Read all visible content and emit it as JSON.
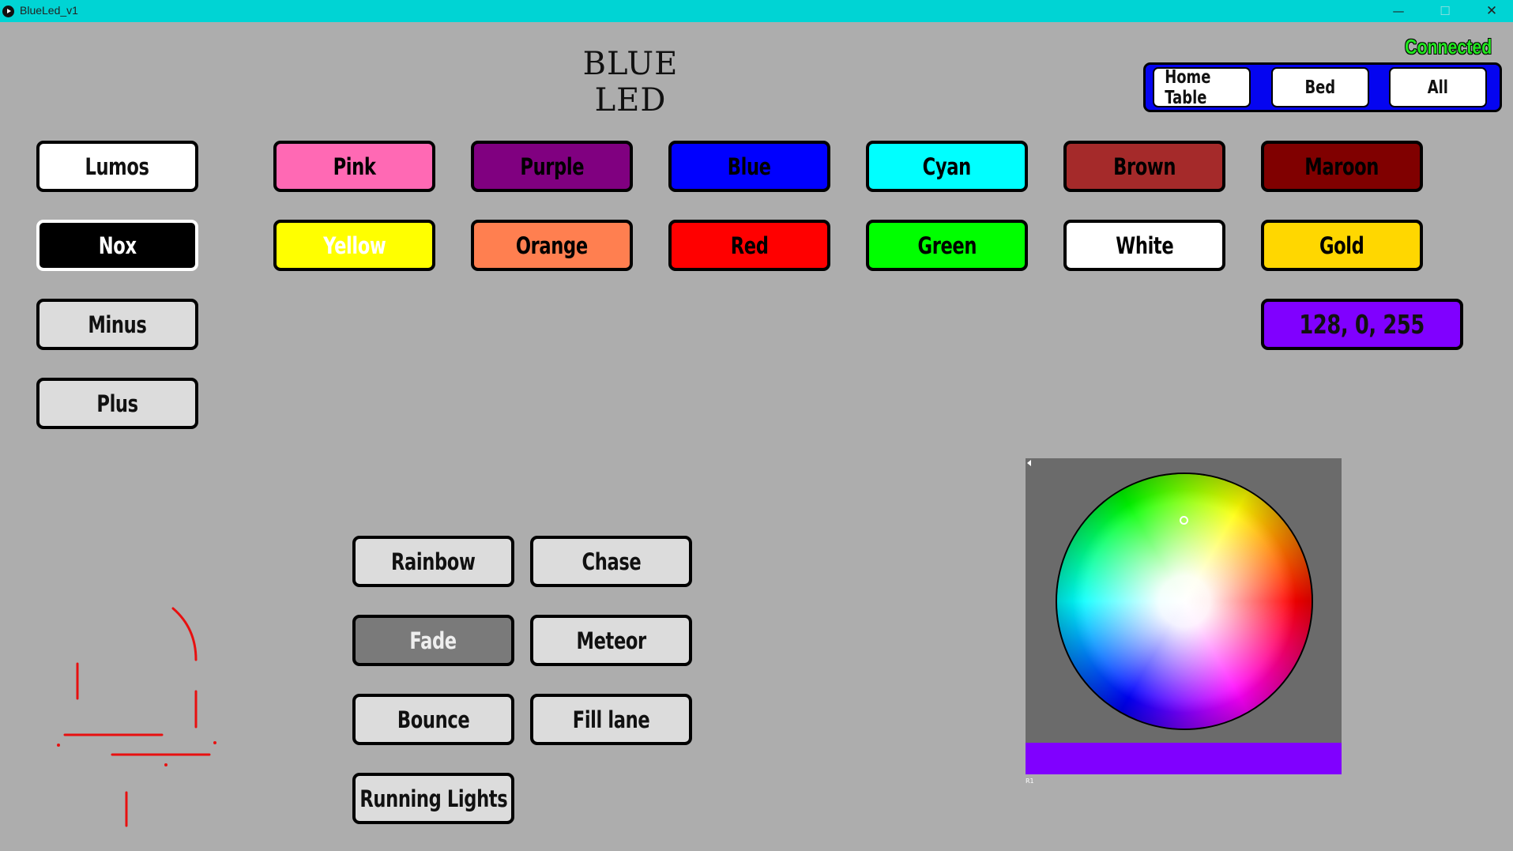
{
  "window": {
    "title": "BlueLed_v1",
    "controls": {
      "minimize": "—",
      "maximize": "☐",
      "close": "✕"
    }
  },
  "page_title": "BLUE LED",
  "status": {
    "text": "Connected",
    "color": "#22e81f"
  },
  "targets": {
    "group_color": "#0505f0",
    "items": [
      {
        "label": "Home Table"
      },
      {
        "label": "Bed"
      },
      {
        "label": "All"
      }
    ]
  },
  "power": {
    "lumos": "Lumos",
    "nox": "Nox",
    "minus": "Minus",
    "plus": "Plus"
  },
  "colors": [
    {
      "label": "Pink",
      "bg": "#ff69b4",
      "fg": "#000000"
    },
    {
      "label": "Purple",
      "bg": "#800080",
      "fg": "#000000"
    },
    {
      "label": "Blue",
      "bg": "#0000ff",
      "fg": "#000000"
    },
    {
      "label": "Cyan",
      "bg": "#00ffff",
      "fg": "#000000"
    },
    {
      "label": "Brown",
      "bg": "#a52a2a",
      "fg": "#000000"
    },
    {
      "label": "Maroon",
      "bg": "#800000",
      "fg": "#000000"
    },
    {
      "label": "Yellow",
      "bg": "#ffff00",
      "fg": "#ffffff"
    },
    {
      "label": "Orange",
      "bg": "#ff7f50",
      "fg": "#000000"
    },
    {
      "label": "Red",
      "bg": "#ff0000",
      "fg": "#000000"
    },
    {
      "label": "Green",
      "bg": "#00ff00",
      "fg": "#000000"
    },
    {
      "label": "White",
      "bg": "#ffffff",
      "fg": "#000000"
    },
    {
      "label": "Gold",
      "bg": "#ffd700",
      "fg": "#000000"
    }
  ],
  "rgb_value": {
    "label": "128, 0, 255",
    "bg": "#8000ff"
  },
  "effects": {
    "rainbow": "Rainbow",
    "chase": "Chase",
    "fade": "Fade",
    "meteor": "Meteor",
    "bounce": "Bounce",
    "fill_lane": "Fill lane",
    "running_lights": "Running Lights"
  },
  "picker": {
    "selected_color": "#8000ff",
    "label": "R1"
  }
}
